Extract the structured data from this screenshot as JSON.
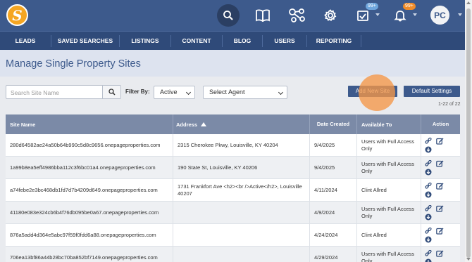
{
  "brand": {
    "logo_letter": "S"
  },
  "header": {
    "messages_badge": "99+",
    "notifications_badge": "99+",
    "avatar_initials": "PC"
  },
  "nav": [
    "LEADS",
    "SAVED SEARCHES",
    "LISTINGS",
    "CONTENT",
    "BLOG",
    "USERS",
    "REPORTING"
  ],
  "page": {
    "title": "Manage Single Property Sites"
  },
  "filters": {
    "search_placeholder": "Search Site Name",
    "filter_label": "Filter By:",
    "status_value": "Active",
    "agent_value": "Select Agent"
  },
  "buttons": {
    "add_new_site": "Add New Site",
    "default_settings": "Default Settings"
  },
  "pagination": {
    "range": "1-22 of 22"
  },
  "table": {
    "headers": {
      "site_name": "Site Name",
      "address": "Address",
      "date_created": "Date Created",
      "available_to": "Available To",
      "action": "Action"
    },
    "rows": [
      {
        "site": "280d64582ae24a50b64b990c5d8c9656.onepageproperties.com",
        "address": "2315 Cherokee Pkwy, Louisville, KY 40204",
        "date": "9/4/2025",
        "available": "Users with Full Access Only"
      },
      {
        "site": "1a99b8ea5eff4986bba112c3f6bc01a4.onepageproperties.com",
        "address": "190 State St, Louisville, KY 40206",
        "date": "9/4/2025",
        "available": "Users with Full Access Only"
      },
      {
        "site": "a74febe2e3bc468db1fd7d7b4209d649.onepageproperties.com",
        "address": "1731 Frankfort Ave <h2><br />Active</h2>, Louisville 40207",
        "date": "4/11/2024",
        "available": "Clint Allred"
      },
      {
        "site": "41180e083e324cb6b4f76db095be0a67.onepageproperties.com",
        "address": "",
        "date": "4/9/2024",
        "available": "Users with Full Access Only"
      },
      {
        "site": "876a5add4d364e5abc97f59f0fdd6a88.onepageproperties.com",
        "address": "",
        "date": "4/24/2024",
        "available": "Clint Allred"
      },
      {
        "site": "706ea13bf86a44b28bc70ba852bf7149.onepageproperties.com",
        "address": "",
        "date": "4/29/2024",
        "available": "Users with Full Access Only"
      }
    ]
  },
  "colors": {
    "primary": "#3d5a8c",
    "nav": "#2f4a79",
    "accent": "#f5a623",
    "highlight": "#f59646"
  }
}
